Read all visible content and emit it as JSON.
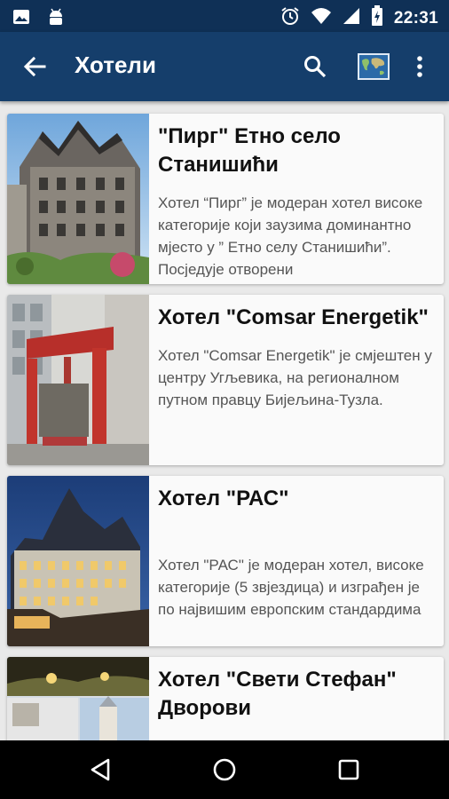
{
  "status_bar": {
    "time": "22:31",
    "icons": [
      "image-icon",
      "android-icon",
      "alarm-icon",
      "wifi-icon",
      "signal-icon",
      "battery-charging-icon"
    ]
  },
  "app_bar": {
    "title": "Хотели",
    "icons": [
      "back-arrow-icon",
      "search-icon",
      "world-map-icon",
      "more-vert-icon"
    ],
    "color": "#153e6b"
  },
  "hotels": [
    {
      "name": "\"Пирг\" Етно село Станишићи",
      "description": "Хотел “Пирг” је модеран хотел високе категорије који заузима доминантно мјесто у ” Етно селу Станишићи”. Посједује отворени"
    },
    {
      "name": "Хотел \"Comsar Energetik\"",
      "description": "Хотел \"Comsar Energetik\" је смјештен у центру Угљевика, на регионалном путном правцу Бијељина-Тузла."
    },
    {
      "name": "Хотел \"РАС\"",
      "description": "Хотел \"РАС\" је модеран хотел, високе категорије (5 звјездица) и изграђен је по највишим европским стандардима"
    },
    {
      "name": "Хотел \"Свети Стефан\" Дворови",
      "description": ""
    }
  ],
  "nav_bar": {
    "icons": [
      "back-triangle-icon",
      "home-circle-icon",
      "recents-square-icon"
    ]
  }
}
